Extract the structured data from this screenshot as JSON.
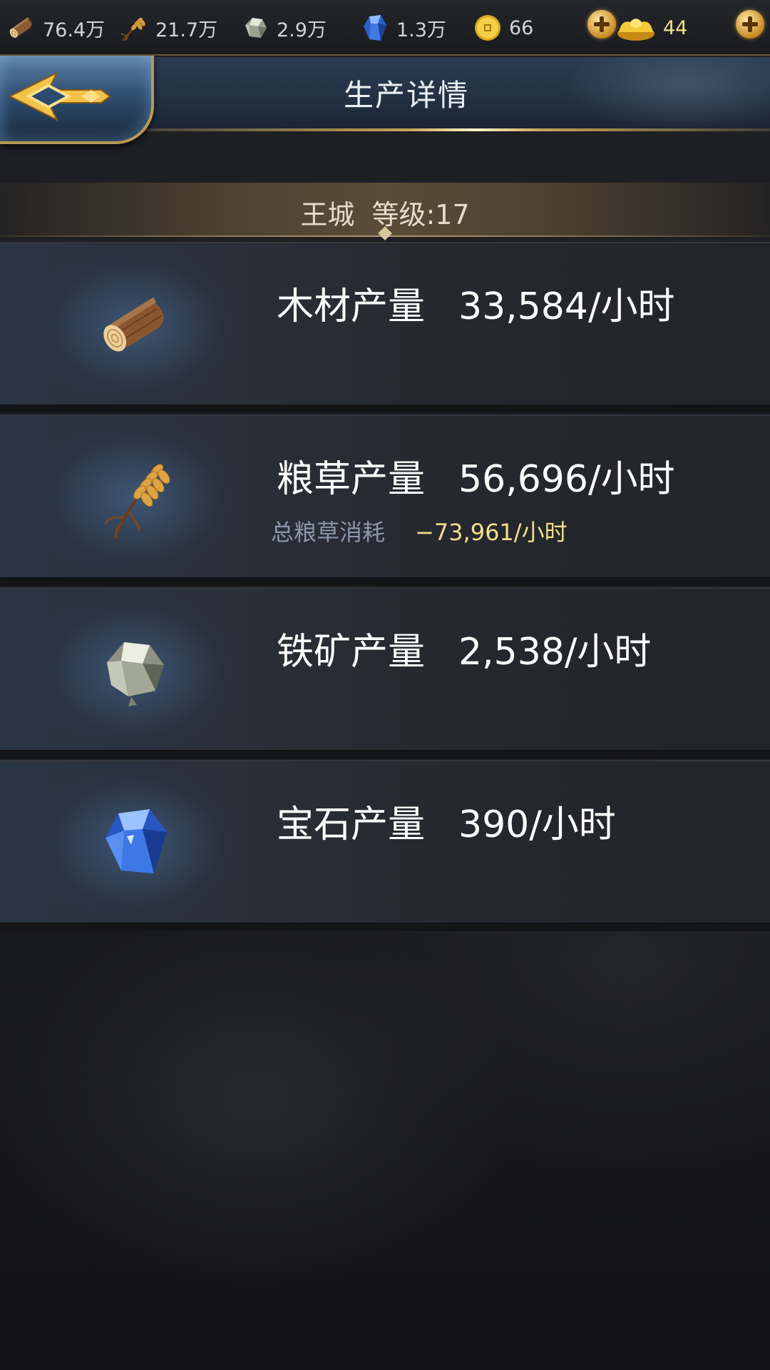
{
  "resources": [
    {
      "icon": "wood-icon",
      "value": "76.4万"
    },
    {
      "icon": "grain-icon",
      "value": "21.7万"
    },
    {
      "icon": "iron-ore-icon",
      "value": "2.9万"
    },
    {
      "icon": "gem-icon",
      "value": "1.3万"
    },
    {
      "icon": "coin-icon",
      "value": "66"
    },
    {
      "icon": "gold-ingot-icon",
      "value": "44"
    }
  ],
  "header": {
    "title": "生产详情",
    "back_icon": "back-arrow-icon"
  },
  "city": {
    "label": "王城  等级:17"
  },
  "rows": [
    {
      "icon": "wood-icon",
      "label": "木材产量",
      "value": "33,584/小时"
    },
    {
      "icon": "grain-icon",
      "label": "粮草产量",
      "value": "56,696/小时",
      "sub_label": "总粮草消耗",
      "sub_value": "−73,961/小时"
    },
    {
      "icon": "iron-ore-icon",
      "label": "铁矿产量",
      "value": "2,538/小时"
    },
    {
      "icon": "gem-icon",
      "label": "宝石产量",
      "value": "390/小时"
    }
  ],
  "colors": {
    "accent_gold": "#c8a55a",
    "consumption_yellow": "#f1e08b",
    "header_blue": "#223143"
  }
}
